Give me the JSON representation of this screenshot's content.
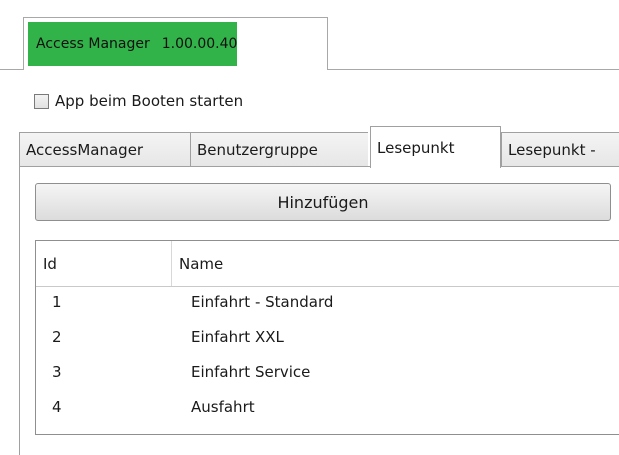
{
  "app_tab": {
    "name": "Access Manager",
    "version": "1.00.00.40",
    "accent_color": "#32b34a"
  },
  "autostart": {
    "label": "App beim Booten starten",
    "checked": false
  },
  "tabs": [
    {
      "label": "AccessManager",
      "selected": false
    },
    {
      "label": "Benutzergruppe",
      "selected": false
    },
    {
      "label": "Lesepunkt",
      "selected": true
    },
    {
      "label": "Lesepunkt -",
      "selected": false
    }
  ],
  "add_button": {
    "label": "Hinzufügen"
  },
  "grid": {
    "columns": [
      "Id",
      "Name"
    ],
    "rows": [
      {
        "id": "1",
        "name": "Einfahrt - Standard"
      },
      {
        "id": "2",
        "name": "Einfahrt XXL"
      },
      {
        "id": "3",
        "name": "Einfahrt Service"
      },
      {
        "id": "4",
        "name": "Ausfahrt"
      }
    ]
  }
}
